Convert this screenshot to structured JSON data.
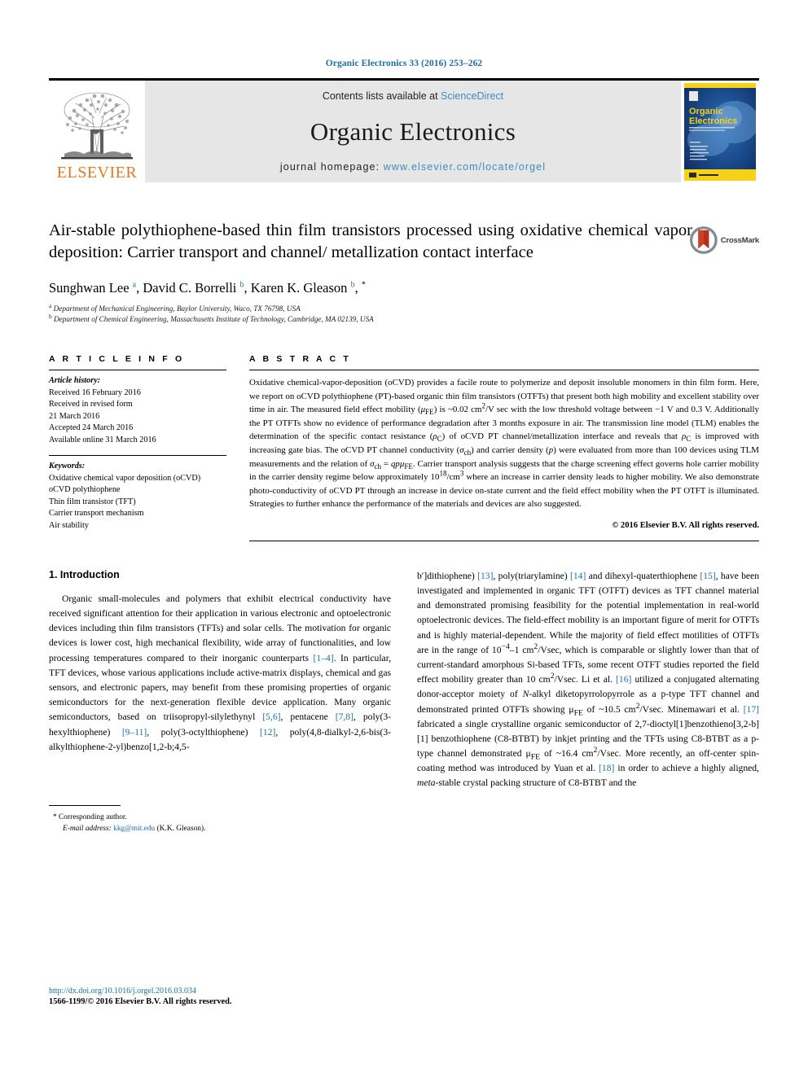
{
  "running_head": "Organic Electronics 33 (2016) 253–262",
  "masthead": {
    "publisher_logo_text": "ELSEVIER",
    "contents_prefix": "Contents lists available at",
    "contents_link": "ScienceDirect",
    "journal_title": "Organic Electronics",
    "homepage_prefix": "journal homepage:",
    "homepage_url": "www.elsevier.com/locate/orgel",
    "cover_title_line1": "Organic",
    "cover_title_line2": "Electronics",
    "accent_link_color": "#3a8dbd",
    "elsevier_orange": "#e87722"
  },
  "article": {
    "title": "Air-stable polythiophene-based thin film transistors processed using oxidative chemical vapor deposition: Carrier transport and channel/ metallization contact interface",
    "crossmark_label": "CrossMark",
    "authors_html": "Sunghwan Lee <sup>a</sup>, David C. Borrelli <sup>b</sup>, Karen K. Gleason <sup>b</sup>, <sup>*</sup>",
    "affiliations": [
      {
        "marker": "a",
        "text": "Department of Mechanical Engineering, Baylor University, Waco, TX 76798, USA"
      },
      {
        "marker": "b",
        "text": "Department of Chemical Engineering, Massachusetts Institute of Technology, Cambridge, MA 02139, USA"
      }
    ]
  },
  "article_info": {
    "heading": "A R T I C L E   I N F O",
    "history_label": "Article history:",
    "history": [
      "Received 16 February 2016",
      "Received in revised form",
      "21 March 2016",
      "Accepted 24 March 2016",
      "Available online 31 March 2016"
    ],
    "keywords_label": "Keywords:",
    "keywords": [
      "Oxidative chemical vapor deposition (oCVD)",
      "oCVD polythiophene",
      "Thin film transistor (TFT)",
      "Carrier transport mechanism",
      "Air stability"
    ]
  },
  "abstract": {
    "heading": "A B S T R A C T",
    "text": "Oxidative chemical-vapor-deposition (oCVD) provides a facile route to polymerize and deposit insoluble monomers in thin film form. Here, we report on oCVD polythiophene (PT)-based organic thin film transistors (OTFTs) that present both high mobility and excellent stability over time in air. The measured field effect mobility (μFE) is ~0.02 cm2/V sec with the low threshold voltage between −1 V and 0.3 V. Additionally the PT OTFTs show no evidence of performance degradation after 3 months exposure in air. The transmission line model (TLM) enables the determination of the specific contact resistance (ρC) of oCVD PT channel/metallization interface and reveals that ρC is improved with increasing gate bias. The oCVD PT channel conductivity (σch) and carrier density (p) were evaluated from more than 100 devices using TLM measurements and the relation of σch = qpμFE. Carrier transport analysis suggests that the charge screening effect governs hole carrier mobility in the carrier density regime below approximately 1018/cm3 where an increase in carrier density leads to higher mobility. We also demonstrate photo-conductivity of oCVD PT through an increase in device on-state current and the field effect mobility when the PT OTFT is illuminated. Strategies to further enhance the performance of the materials and devices are also suggested.",
    "copyright": "© 2016 Elsevier B.V. All rights reserved."
  },
  "introduction": {
    "heading": "1. Introduction",
    "left_paragraph_1": "Organic small-molecules and polymers that exhibit electrical conductivity have received significant attention for their application in various electronic and optoelectronic devices including thin film transistors (TFTs) and solar cells. The motivation for organic devices is lower cost, high mechanical flexibility, wide array of functionalities, and low processing temperatures compared to their inorganic counterparts [1–4]. In particular, TFT devices, whose various applications include active-matrix displays, chemical and gas sensors, and electronic papers, may benefit from these promising properties of organic semiconductors for the next-generation flexible device application. Many organic semiconductors, based on triisopropyl-silylethynyl [5,6], pentacene [7,8], poly(3-hexylthiophene) [9–11], poly(3-octylthiophene) [12], poly(4,8-dialkyl-2,6-bis(3-alkylthiophene-2-yl)benzo[1,2-b;4,5-b′]dithiophene) [13], poly(triarylamine) [14] and dihexyl-quaterthiophene [15], have been investigated and implemented in organic TFT (OTFT) devices as TFT channel material and demonstrated promising feasibility for the potential implementation in real-world optoelectronic devices. The field-effect mobility is an important figure of merit for OTFTs and is highly material-dependent. While the majority of field effect motilities of OTFTs are in the range of 10−4–1 cm2/Vsec, which is comparable or slightly lower than that of current-standard amorphous Si-based TFTs, some recent OTFT studies reported the field effect mobility greater than 10 cm2/Vsec. Li et al. [16] utilized a conjugated alternating donor-acceptor moiety of N-alkyl diketopyrrolopyrrole as a p-type TFT channel and demonstrated printed OTFTs showing μFE of ~10.5 cm2/Vsec. Minemawari et al. [17] fabricated a single crystalline organic semiconductor of 2,7-dioctyl[1]benzothieno[3,2-b][1] benzothiophene (C8-BTBT) by inkjet printing and the TFTs using C8-BTBT as a p-type channel demonstrated μFE of ~16.4 cm2/Vsec. More recently, an off-center spin-coating method was introduced by Yuan et al. [18] in order to achieve a highly aligned, meta-stable crystal packing structure of C8-BTBT and the",
    "citation_color": "#1b70a8"
  },
  "footnote": {
    "corresponding_label": "Corresponding author.",
    "email_label": "E-mail address:",
    "email": "kkg@mit.edu",
    "email_owner": "(K.K. Gleason)."
  },
  "page_footer": {
    "doi": "http://dx.doi.org/10.1016/j.orgel.2016.03.034",
    "issn_line": "1566-1199/© 2016 Elsevier B.V. All rights reserved."
  }
}
